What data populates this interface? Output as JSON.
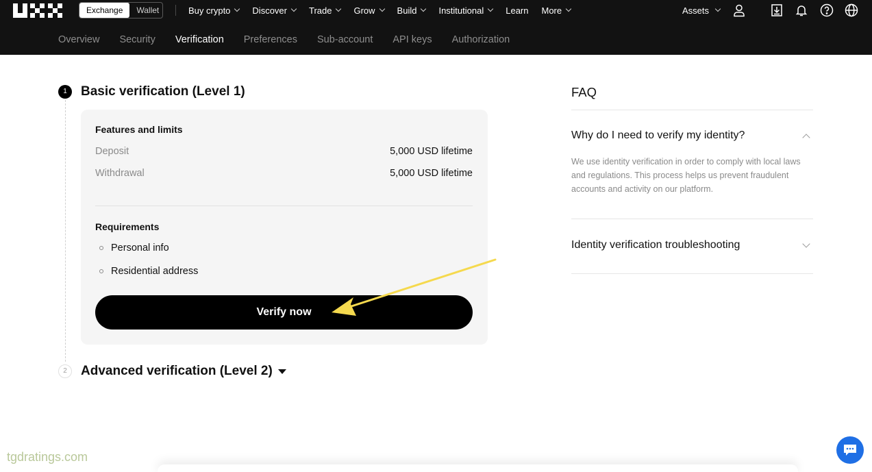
{
  "header": {
    "switch": {
      "exchange": "Exchange",
      "wallet": "Wallet"
    },
    "nav": [
      "Buy crypto",
      "Discover",
      "Trade",
      "Grow",
      "Build",
      "Institutional",
      "Learn",
      "More"
    ],
    "assets": "Assets"
  },
  "subnav": [
    "Overview",
    "Security",
    "Verification",
    "Preferences",
    "Sub-account",
    "API keys",
    "Authorization"
  ],
  "basic": {
    "step": "1",
    "title": "Basic verification (Level 1)",
    "features_heading": "Features and limits",
    "deposit_label": "Deposit",
    "deposit_value": "5,000 USD lifetime",
    "withdrawal_label": "Withdrawal",
    "withdrawal_value": "5,000 USD lifetime",
    "requirements_heading": "Requirements",
    "requirements": [
      "Personal info",
      "Residential address"
    ],
    "button": "Verify now"
  },
  "advanced": {
    "step": "2",
    "title": "Advanced verification (Level 2)"
  },
  "faq": {
    "title": "FAQ",
    "q1": "Why do I need to verify my identity?",
    "a1": "We use identity verification in order to comply with local laws and regulations. This process helps us prevent fraudulent accounts and activity on our platform.",
    "q2": "Identity verification troubleshooting"
  },
  "watermark": "tgdratings.com",
  "colors": {
    "annotation_arrow": "#f5d94e",
    "chat": "#1f6fe5"
  }
}
